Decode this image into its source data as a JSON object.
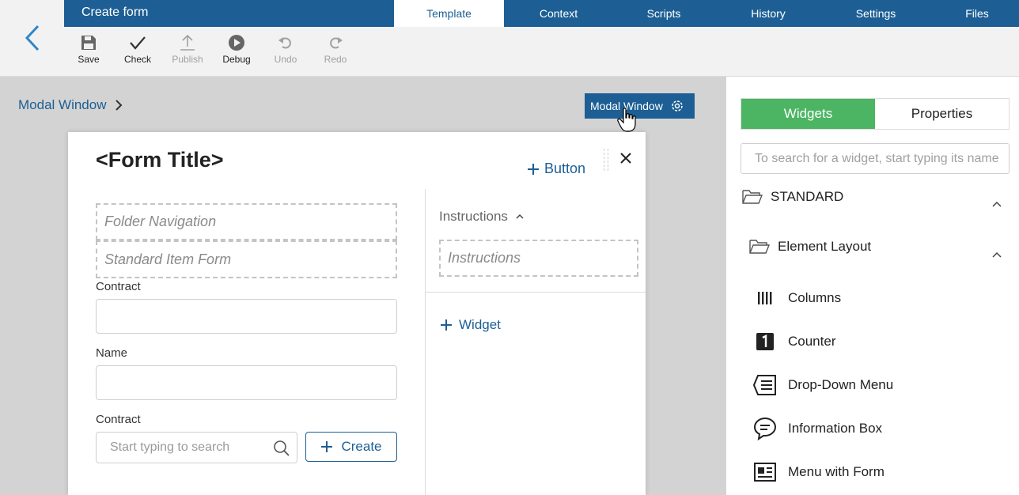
{
  "header": {
    "title": "Create form",
    "tabs": [
      "Template",
      "Context",
      "Scripts",
      "History",
      "Settings",
      "Files"
    ],
    "active_tab": "Template"
  },
  "toolbar": {
    "save": "Save",
    "check": "Check",
    "publish": "Publish",
    "debug": "Debug",
    "undo": "Undo",
    "redo": "Redo"
  },
  "canvas": {
    "breadcrumb": "Modal Window",
    "selection_tag": "Modal Window"
  },
  "modal": {
    "title": "<Form Title>",
    "add_button": "Button",
    "placeholders": [
      "Folder Navigation",
      "Standard Item Form"
    ],
    "fields": [
      {
        "label": "Contract",
        "value": ""
      },
      {
        "label": "Name",
        "value": ""
      }
    ],
    "lookup": {
      "label": "Contract",
      "placeholder": "Start typing to search",
      "create_label": "Create"
    },
    "instructions": {
      "header": "Instructions",
      "placeholder": "Instructions"
    },
    "add_widget": "Widget"
  },
  "panel": {
    "tabs": [
      "Widgets",
      "Properties"
    ],
    "active_tab": "Widgets",
    "search_placeholder": "To search for a widget, start typing its name",
    "group": "STANDARD",
    "subgroup": "Element Layout",
    "items": [
      {
        "label": "Columns",
        "icon": "columns-icon"
      },
      {
        "label": "Counter",
        "icon": "counter-icon"
      },
      {
        "label": "Drop-Down Menu",
        "icon": "dropdown-menu-icon"
      },
      {
        "label": "Information Box",
        "icon": "information-box-icon"
      },
      {
        "label": "Menu with Form",
        "icon": "menu-with-form-icon"
      }
    ]
  },
  "colors": {
    "brand": "#1d5f94",
    "accent_green": "#4cb563",
    "canvas_bg": "#d3d3d3"
  }
}
